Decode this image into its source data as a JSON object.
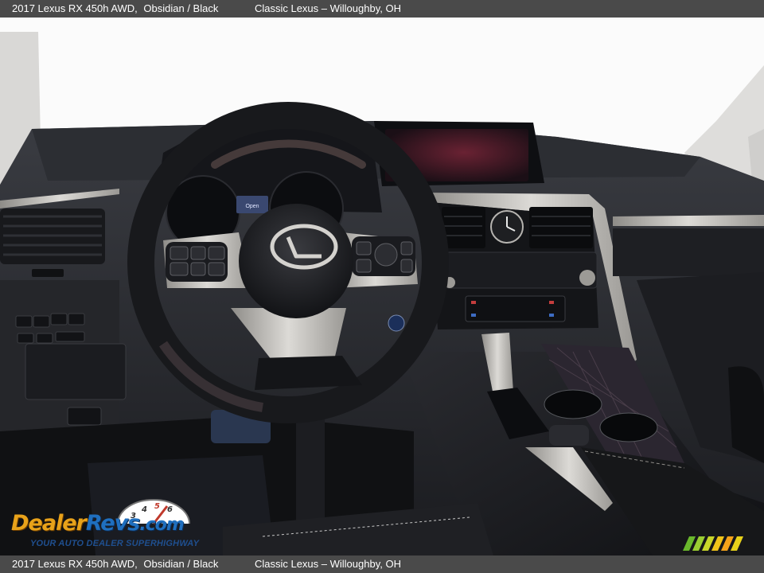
{
  "top_caption": {
    "vehicle": "2017 Lexus RX 450h AWD,",
    "colors": "Obsidian / Black",
    "dealer": "Classic Lexus – Willoughby, OH"
  },
  "bottom_caption": {
    "vehicle": "2017 Lexus RX 450h AWD,",
    "colors": "Obsidian / Black",
    "dealer": "Classic Lexus – Willoughby, OH"
  },
  "watermark": {
    "brand_dealer": "Dealer",
    "brand_revs": "Revs",
    "brand_com": ".com",
    "tagline": "YOUR AUTO DEALER SUPERHIGHWAY"
  },
  "photo": {
    "cluster_label": "Open",
    "colors": {
      "caption_bar": "#4a4a4a",
      "dash_dark": "#1e1f23",
      "trim_silver": "#c8c6c2",
      "leather_black": "#141518",
      "windshield": "#fbfbfb"
    }
  },
  "icons": {
    "lexus_emblem": "lexus-logo-icon",
    "clock": "analog-clock-icon",
    "corner_logo": "mmm-logo-icon"
  }
}
